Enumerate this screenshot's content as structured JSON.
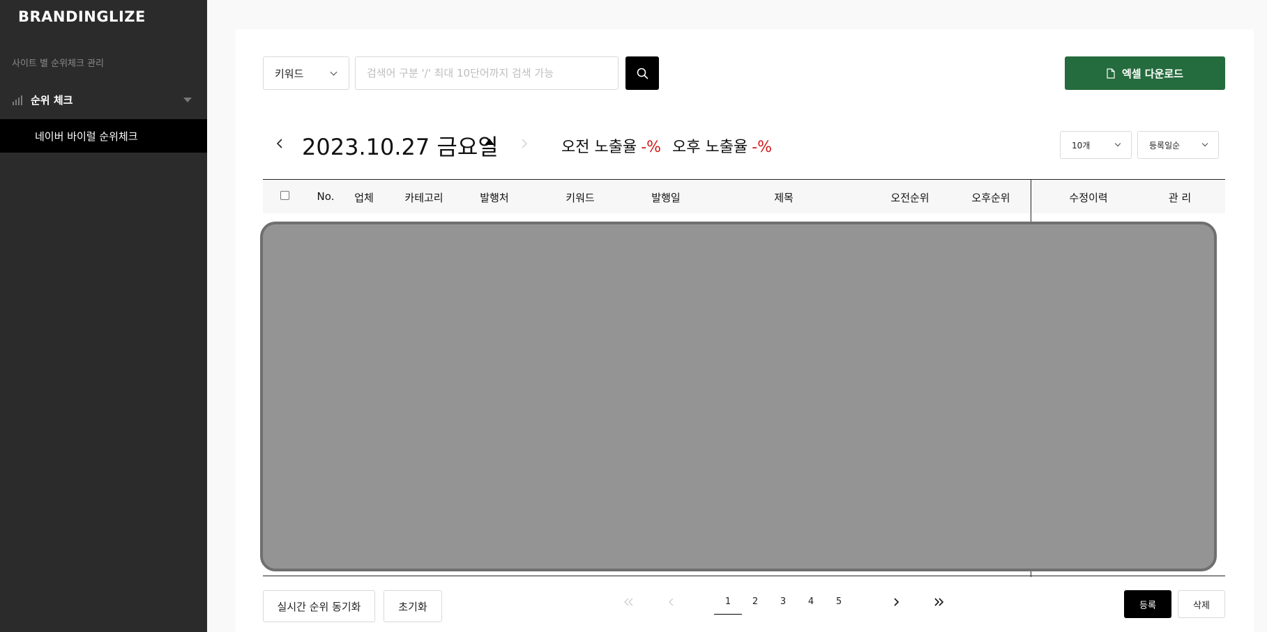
{
  "sidebar": {
    "brand": "BRANDINGLIZE",
    "section_label": "사이트 별 순위체크 관리",
    "group": {
      "icon": "bar-chart-icon",
      "label": "순위 체크"
    },
    "sub_item": "네이버 바이럴 순위체크"
  },
  "search": {
    "type_value": "키워드",
    "placeholder": "검색어 구분 '/' 최대 10단어까지 검색 가능"
  },
  "excel_button": "엑셀 다운로드",
  "date_bar": {
    "date": "2023.10.27 금요일",
    "am_label": "오전 노출율",
    "am_value": "-%",
    "pm_label": "오후 노출율",
    "pm_value": "-%"
  },
  "filters": {
    "count": "10개",
    "sort": "등록일순"
  },
  "table": {
    "columns": [
      "No.",
      "업체",
      "카테고리",
      "발행처",
      "키워드",
      "발행일",
      "제목",
      "오전순위",
      "오후순위",
      "수정이력",
      "관 리"
    ]
  },
  "footer": {
    "sync_button": "실시간 순위 동기화",
    "reset_button": "초기화",
    "pages": [
      "1",
      "2",
      "3",
      "4",
      "5"
    ],
    "current_page": "1",
    "register_button": "등록",
    "delete_button": "삭제"
  },
  "colors": {
    "sidebar_bg": "#2b2b2b",
    "excel_green": "#246b3d",
    "rate_red": "#d11a1a"
  }
}
